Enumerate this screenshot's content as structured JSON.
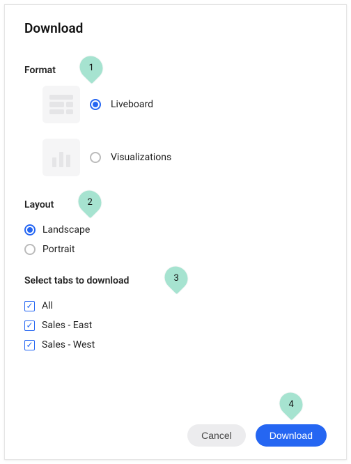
{
  "title": "Download",
  "format": {
    "label": "Format",
    "options": [
      {
        "label": "Liveboard",
        "selected": true
      },
      {
        "label": "Visualizations",
        "selected": false
      }
    ]
  },
  "layout": {
    "label": "Layout",
    "options": [
      {
        "label": "Landscape",
        "selected": true
      },
      {
        "label": "Portrait",
        "selected": false
      }
    ]
  },
  "tabs": {
    "label": "Select tabs to download",
    "options": [
      {
        "label": "All",
        "checked": true
      },
      {
        "label": "Sales - East",
        "checked": true
      },
      {
        "label": "Sales - West",
        "checked": true
      }
    ]
  },
  "buttons": {
    "cancel": "Cancel",
    "download": "Download"
  },
  "markers": {
    "m1": "1",
    "m2": "2",
    "m3": "3",
    "m4": "4"
  }
}
